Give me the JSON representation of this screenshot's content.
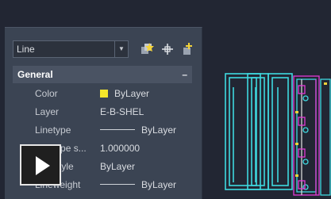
{
  "toolbar": {
    "object_type": "Line",
    "dropdown_arrow": "▼",
    "icons": [
      "quick-select-icon",
      "select-objects-icon",
      "toggle-pickadd-icon"
    ]
  },
  "section": {
    "title": "General",
    "collapse": "–"
  },
  "properties": [
    {
      "label": "Color",
      "value": "ByLayer",
      "swatch": "#f5e62a"
    },
    {
      "label": "Layer",
      "value": "E-B-SHEL"
    },
    {
      "label": "Linetype",
      "value": "ByLayer"
    },
    {
      "label": "Linetype s...",
      "value": "1.000000"
    },
    {
      "label": "Plot style",
      "value": "ByLayer"
    },
    {
      "label": "Lineweight",
      "value": "ByLayer"
    }
  ],
  "colors": {
    "accent_cyan": "#3fd9e0",
    "accent_magenta": "#e33ad6",
    "background": "#222633"
  }
}
